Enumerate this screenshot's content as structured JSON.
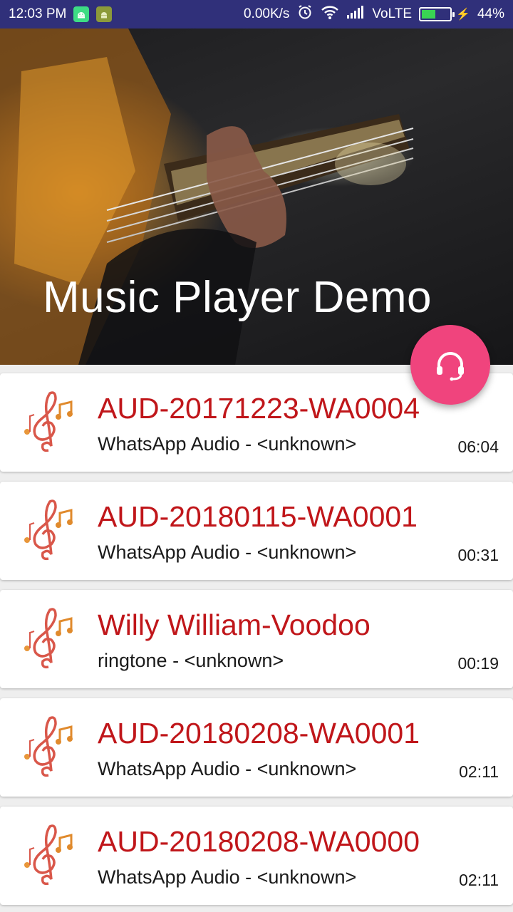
{
  "status_bar": {
    "time": "12:03 PM",
    "net_speed": "0.00K/s",
    "network": "VoLTE",
    "battery": "44%",
    "battery_level": 0.44,
    "icons": [
      "android-debug-icon",
      "android-app-icon",
      "alarm-icon",
      "wifi-icon",
      "signal-icon",
      "battery-icon",
      "charging-icon"
    ]
  },
  "header": {
    "title": "Music Player Demo"
  },
  "fab": {
    "icon": "headphones-icon",
    "color": "#f0447d"
  },
  "colors": {
    "title_red": "#c0161a",
    "status_bar": "#30307a"
  },
  "songs": [
    {
      "title": "AUD-20171223-WA0004",
      "subtitle": "WhatsApp Audio - <unknown>",
      "duration": "06:04"
    },
    {
      "title": "AUD-20180115-WA0001",
      "subtitle": "WhatsApp Audio - <unknown>",
      "duration": "00:31"
    },
    {
      "title": "Willy William-Voodoo",
      "subtitle": "ringtone - <unknown>",
      "duration": "00:19"
    },
    {
      "title": "AUD-20180208-WA0001",
      "subtitle": "WhatsApp Audio - <unknown>",
      "duration": "02:11"
    },
    {
      "title": "AUD-20180208-WA0000",
      "subtitle": "WhatsApp Audio - <unknown>",
      "duration": "02:11"
    }
  ]
}
